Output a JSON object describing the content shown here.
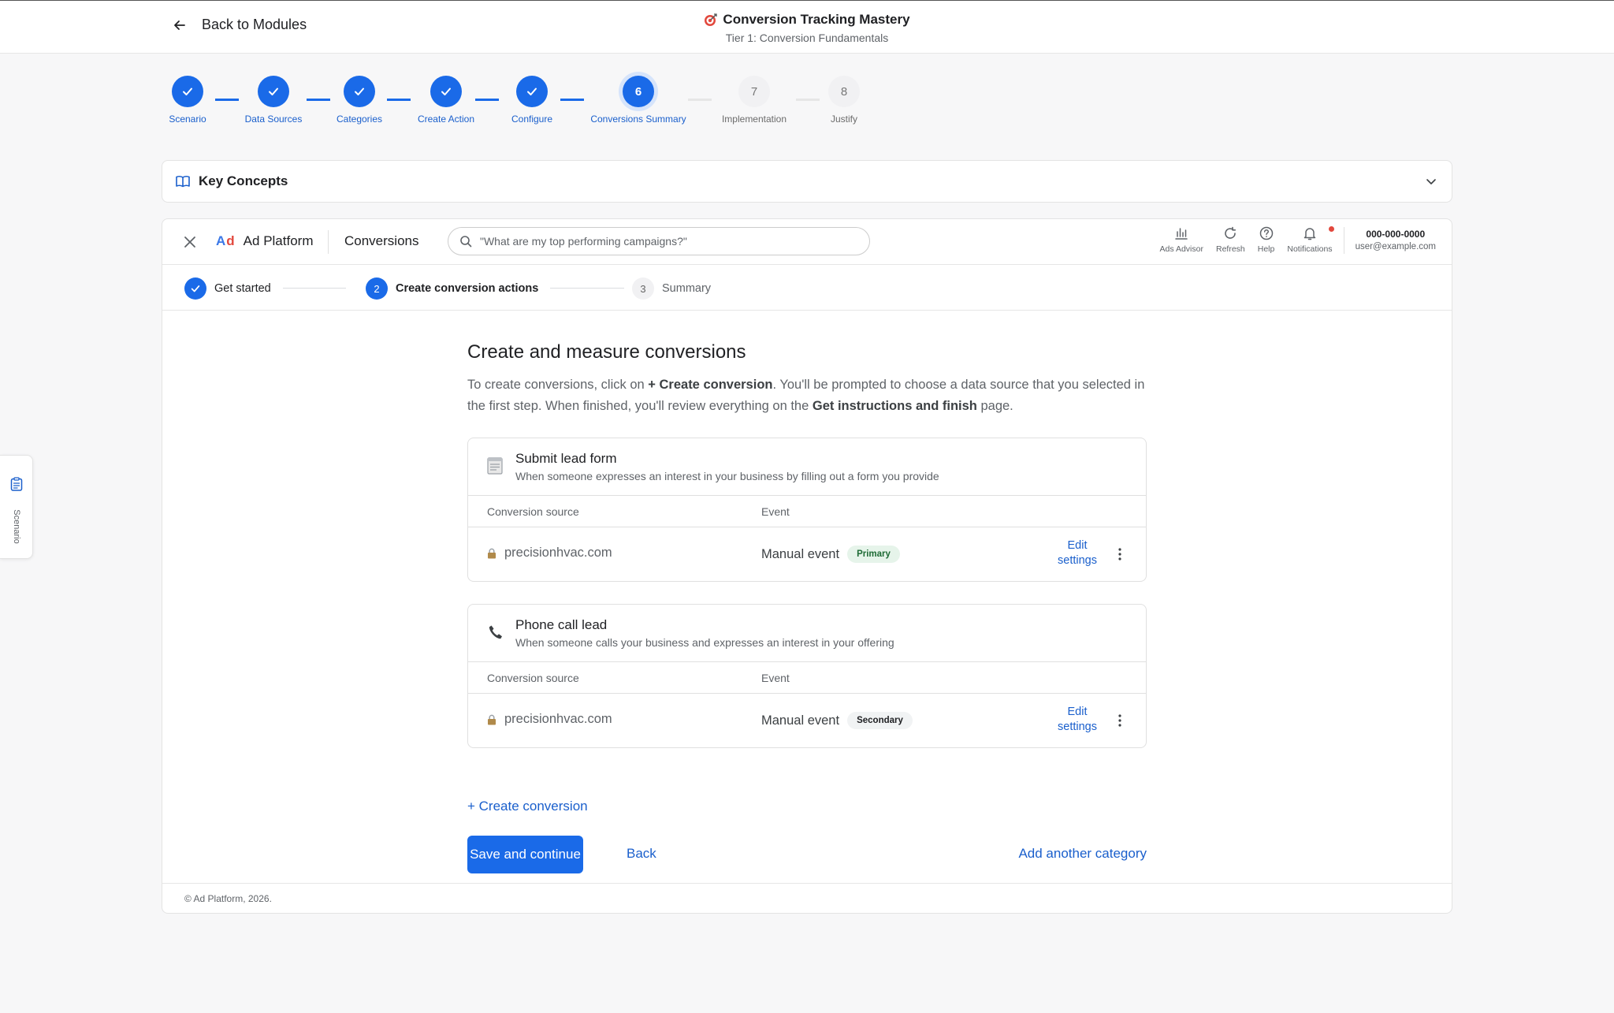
{
  "header": {
    "back_label": "Back to Modules",
    "module_title": "Conversion Tracking Mastery",
    "module_subtitle": "Tier 1: Conversion Fundamentals"
  },
  "module_steps": [
    {
      "number": "1",
      "label": "Scenario",
      "state": "done"
    },
    {
      "number": "2",
      "label": "Data Sources",
      "state": "done"
    },
    {
      "number": "3",
      "label": "Categories",
      "state": "done"
    },
    {
      "number": "4",
      "label": "Create Action",
      "state": "done"
    },
    {
      "number": "5",
      "label": "Configure",
      "state": "done"
    },
    {
      "number": "6",
      "label": "Conversions Summary",
      "state": "current"
    },
    {
      "number": "7",
      "label": "Implementation",
      "state": "todo"
    },
    {
      "number": "8",
      "label": "Justify",
      "state": "todo"
    }
  ],
  "key_concepts": {
    "label": "Key Concepts"
  },
  "platform": {
    "logo_a": "A",
    "logo_d": "d",
    "name": "Ad Platform",
    "section": "Conversions",
    "search_placeholder": "\"What are my top performing campaigns?\"",
    "tools": [
      {
        "label": "Ads Advisor",
        "icon": "bar-chart-icon"
      },
      {
        "label": "Refresh",
        "icon": "refresh-icon"
      },
      {
        "label": "Help",
        "icon": "help-icon"
      },
      {
        "label": "Notifications",
        "icon": "bell-icon"
      }
    ],
    "account_number": "000-000-0000",
    "account_email": "user@example.com"
  },
  "platform_steps": [
    {
      "number": "1",
      "label": "Get started",
      "state": "done"
    },
    {
      "number": "2",
      "label": "Create conversion actions",
      "state": "current"
    },
    {
      "number": "3",
      "label": "Summary",
      "state": "todo"
    }
  ],
  "main": {
    "title": "Create and measure conversions",
    "intro_1": "To create conversions, click on ",
    "intro_bold_1": "+ Create conversion",
    "intro_2": ". You'll be prompted to choose a data source that you selected in the first step. When finished, you'll review everything on the ",
    "intro_bold_2": "Get instructions and finish",
    "intro_3": " page.",
    "col_source": "Conversion source",
    "col_event": "Event",
    "conversions": [
      {
        "name": "Submit lead form",
        "description": "When someone expresses an interest in your business by filling out a form you provide",
        "icon": "form-icon",
        "source": "precisionhvac.com",
        "event": "Manual event",
        "badge": "Primary",
        "edit_line1": "Edit",
        "edit_line2": "settings"
      },
      {
        "name": "Phone call lead",
        "description": "When someone calls your business and expresses an interest in your offering",
        "icon": "phone-icon",
        "source": "precisionhvac.com",
        "event": "Manual event",
        "badge": "Secondary",
        "edit_line1": "Edit",
        "edit_line2": "settings"
      }
    ],
    "create_conversion": "+ Create conversion",
    "save_continue": "Save and continue",
    "back": "Back",
    "add_category": "Add another category"
  },
  "footer": {
    "copyright": "© Ad Platform, 2026."
  },
  "side_tab": {
    "label": "Scenario",
    "icon": "clipboard-icon"
  },
  "colors": {
    "accent": "#1a6ae8",
    "primary_badge_bg": "#e6f4ea",
    "notification_dot": "#e2483d"
  }
}
